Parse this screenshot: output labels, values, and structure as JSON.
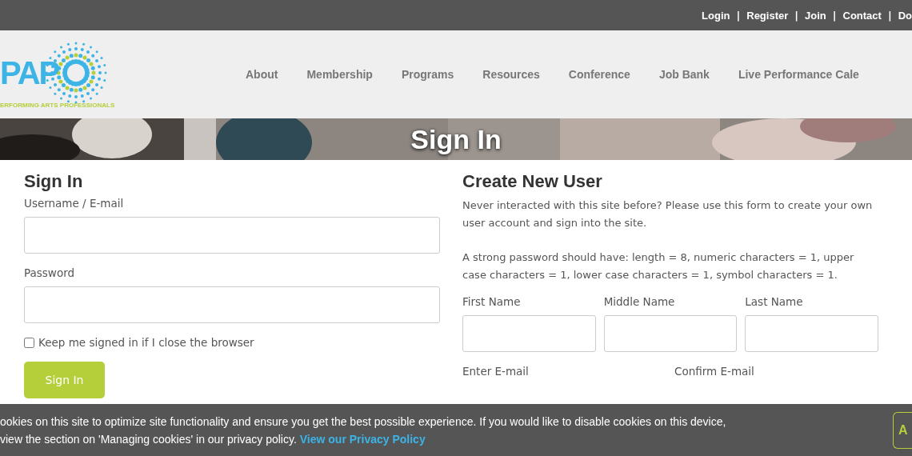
{
  "top_links": [
    "Login",
    "Register",
    "Join",
    "Contact",
    "Do"
  ],
  "top_separator": "|",
  "logo": {
    "mark": "PAP",
    "tagline": "ERFORMING ARTS PROFESSIONALS"
  },
  "nav": [
    "About",
    "Membership",
    "Programs",
    "Resources",
    "Conference",
    "Job Bank",
    "Live Performance Cale"
  ],
  "banner": {
    "title": "Sign In"
  },
  "sign_in": {
    "heading": "Sign In",
    "username_label": "Username / E-mail",
    "password_label": "Password",
    "remember": {
      "label": "Keep me signed in if I close the browser",
      "checked": false
    },
    "button": "Sign In"
  },
  "create_user": {
    "heading": "Create New User",
    "intro": "Never interacted with this site before? Please use this form to create your own user account and sign into the site.",
    "password_rules": "A strong password should have: length = 8, numeric characters = 1, upper case characters = 1, lower case characters = 1, symbol characters = 1.",
    "name_fields": [
      "First Name",
      "Middle Name",
      "Last Name"
    ],
    "email_fields": [
      "Enter E-mail",
      "Confirm E-mail"
    ]
  },
  "cookie_bar": {
    "line_1": "ookies on this site to optimize site functionality and ensure you get the best possible experience. If you would like to disable cookies on this device,",
    "line_2": "view the section on 'Managing cookies' in our privacy policy.",
    "link": "View our Privacy Policy",
    "button": "A"
  }
}
